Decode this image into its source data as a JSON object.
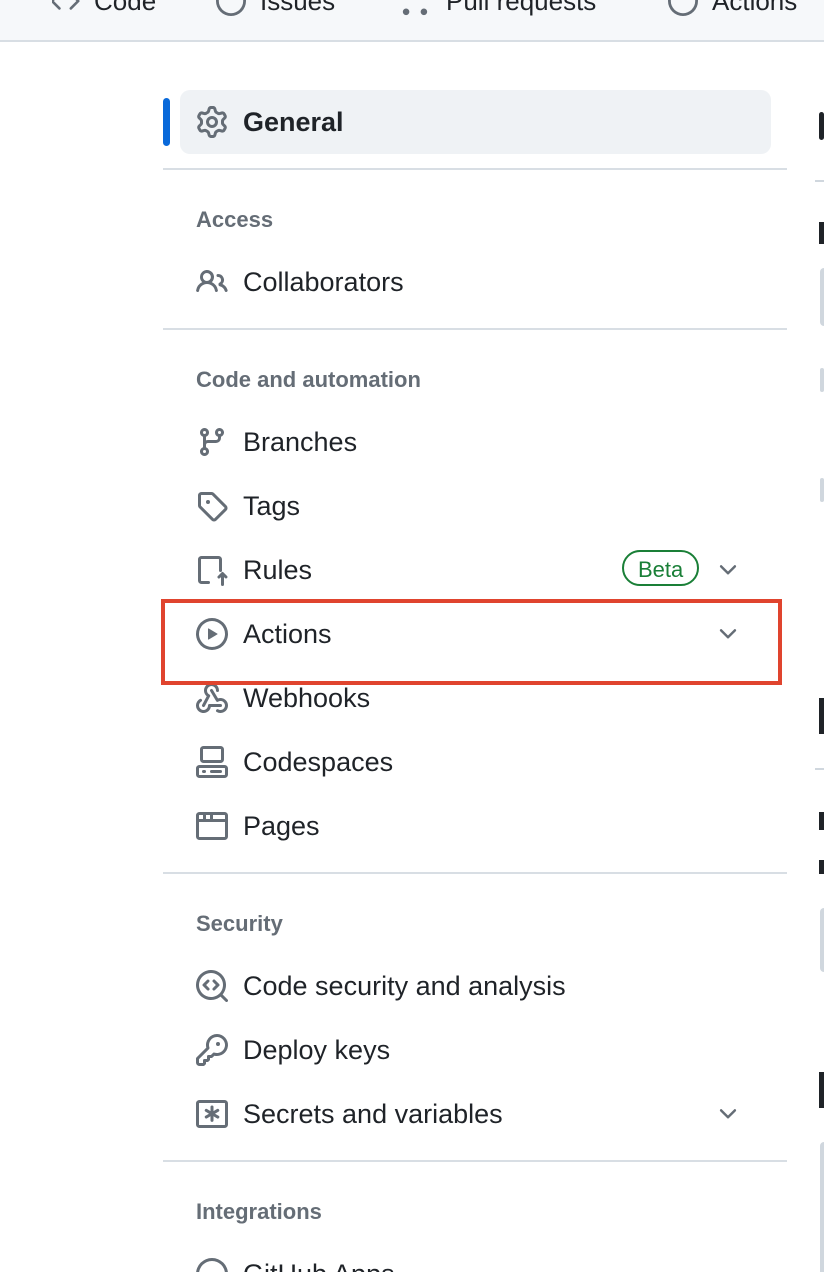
{
  "topnav": {
    "items": [
      {
        "label": "Code",
        "icon": "code-icon"
      },
      {
        "label": "Issues",
        "icon": "issue-icon"
      },
      {
        "label": "Pull requests",
        "icon": "pull-request-icon"
      },
      {
        "label": "Actions",
        "icon": "play-icon"
      }
    ]
  },
  "sidebar": {
    "general": {
      "label": "General",
      "icon": "gear-icon",
      "active": true
    },
    "sections": [
      {
        "heading": "Access",
        "items": [
          {
            "label": "Collaborators",
            "icon": "people-icon"
          }
        ]
      },
      {
        "heading": "Code and automation",
        "items": [
          {
            "label": "Branches",
            "icon": "branch-icon"
          },
          {
            "label": "Tags",
            "icon": "tag-icon"
          },
          {
            "label": "Rules",
            "icon": "rules-icon",
            "badge": "Beta",
            "expandable": true
          },
          {
            "label": "Actions",
            "icon": "play-icon",
            "expandable": true,
            "highlighted": true
          },
          {
            "label": "Webhooks",
            "icon": "webhook-icon"
          },
          {
            "label": "Codespaces",
            "icon": "codespaces-icon"
          },
          {
            "label": "Pages",
            "icon": "browser-icon"
          }
        ]
      },
      {
        "heading": "Security",
        "items": [
          {
            "label": "Code security and analysis",
            "icon": "codescan-icon"
          },
          {
            "label": "Deploy keys",
            "icon": "key-icon"
          },
          {
            "label": "Secrets and variables",
            "icon": "asterisk-icon",
            "expandable": true
          }
        ]
      },
      {
        "heading": "Integrations",
        "items": [
          {
            "label": "GitHub Apps",
            "icon": "apps-icon"
          }
        ]
      }
    ]
  },
  "colors": {
    "accent": "#0969da",
    "highlight": "#e0442e",
    "beta": "#1a7f37",
    "muted": "#656d76"
  }
}
